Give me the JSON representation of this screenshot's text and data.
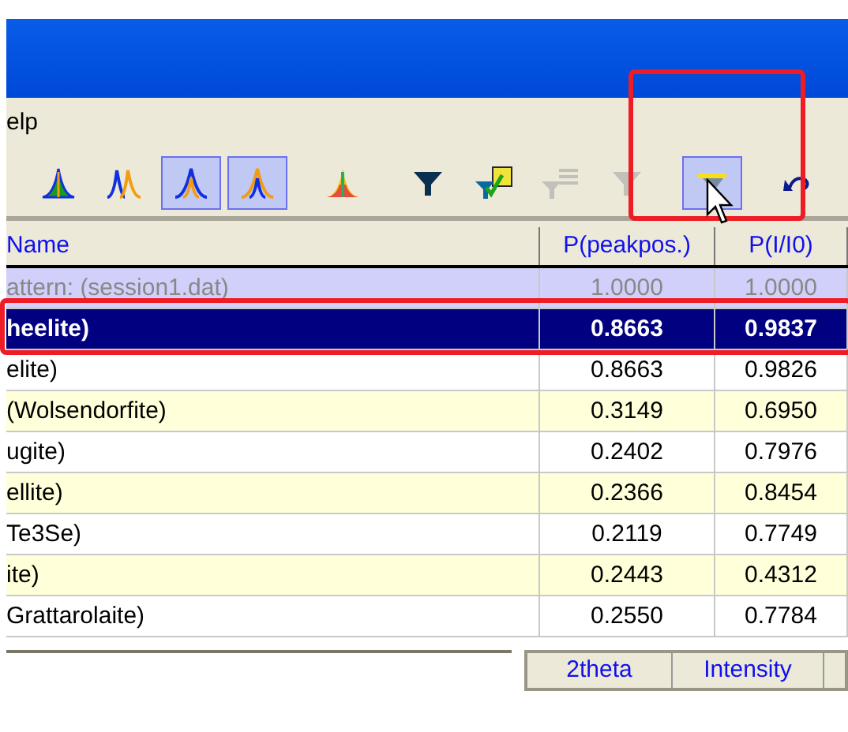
{
  "menu": {
    "items": [
      "elp"
    ]
  },
  "toolbar": {
    "buttons": [
      {
        "kind": "peak-single",
        "pressed": false
      },
      {
        "kind": "peak-multi",
        "pressed": false
      },
      {
        "kind": "peak-orange",
        "pressed": true
      },
      {
        "kind": "peak-blue",
        "pressed": true
      },
      {
        "kind": "peak-rainbow",
        "pressed": false
      },
      {
        "kind": "filter",
        "pressed": false
      },
      {
        "kind": "filter-check",
        "pressed": false,
        "disabled": false
      },
      {
        "kind": "filter-list",
        "pressed": false,
        "disabled": true
      },
      {
        "kind": "filter",
        "pressed": false,
        "disabled": true
      },
      {
        "kind": "filter-clear",
        "pressed": true
      },
      {
        "kind": "undo",
        "pressed": false
      }
    ]
  },
  "table": {
    "columns": [
      "Name",
      "P(peakpos.)",
      "P(I/I0)"
    ],
    "rows": [
      {
        "kind": "pattern",
        "selected": false,
        "cells": [
          "attern: (session1.dat)",
          "1.0000",
          "1.0000"
        ]
      },
      {
        "kind": "hit",
        "selected": true,
        "cells": [
          "heelite)",
          "0.8663",
          "0.9837"
        ]
      },
      {
        "kind": "hit",
        "selected": false,
        "cells": [
          "elite)",
          "0.8663",
          "0.9826"
        ]
      },
      {
        "kind": "hit",
        "selected": false,
        "cells": [
          "(Wolsendorfite)",
          "0.3149",
          "0.6950"
        ]
      },
      {
        "kind": "hit",
        "selected": false,
        "cells": [
          "ugite)",
          "0.2402",
          "0.7976"
        ]
      },
      {
        "kind": "hit",
        "selected": false,
        "cells": [
          "ellite)",
          "0.2366",
          "0.8454"
        ]
      },
      {
        "kind": "hit",
        "selected": false,
        "cells": [
          "Te3Se)",
          "0.2119",
          "0.7749"
        ]
      },
      {
        "kind": "hit",
        "selected": false,
        "cells": [
          "ite)",
          "0.2443",
          "0.4312"
        ]
      },
      {
        "kind": "hit",
        "selected": false,
        "cells": [
          "Grattarolaite)",
          "0.2550",
          "0.7784"
        ]
      }
    ]
  },
  "lower_table": {
    "columns": [
      "2theta",
      "Intensity"
    ]
  }
}
